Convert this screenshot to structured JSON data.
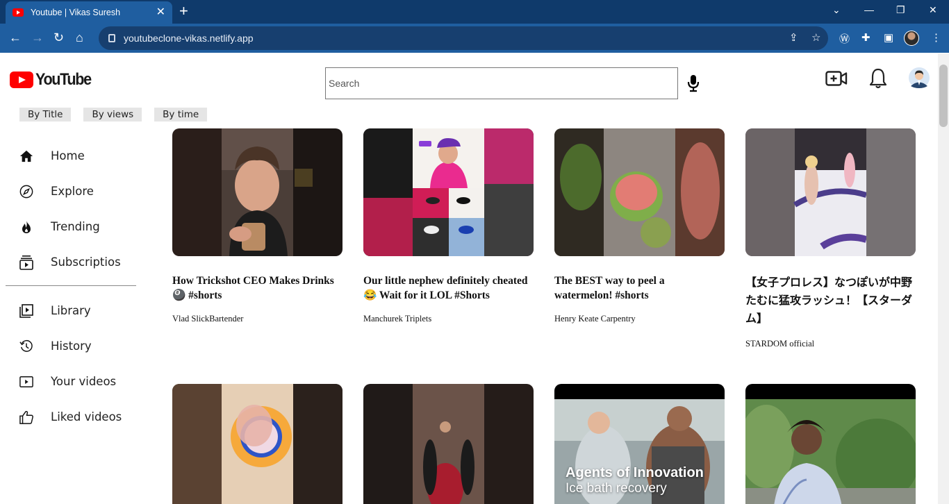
{
  "browser": {
    "tab_title": "Youtube | Vikas Suresh",
    "url": "youtubeclone-vikas.netlify.app"
  },
  "header": {
    "logo_text": "YouTube",
    "search_placeholder": "Search"
  },
  "filters": [
    "By Title",
    "By views",
    "By time"
  ],
  "sidebar": {
    "primary": [
      {
        "label": "Home",
        "icon": "home-icon"
      },
      {
        "label": "Explore",
        "icon": "compass-icon"
      },
      {
        "label": "Trending",
        "icon": "fire-icon"
      },
      {
        "label": "Subscriptios",
        "icon": "subscriptions-icon"
      }
    ],
    "secondary": [
      {
        "label": "Library",
        "icon": "library-icon"
      },
      {
        "label": "History",
        "icon": "history-icon"
      },
      {
        "label": "Your videos",
        "icon": "your-videos-icon"
      },
      {
        "label": "Liked videos",
        "icon": "thumbs-up-icon"
      }
    ]
  },
  "videos": [
    {
      "title": "How Trickshot CEO Makes Drinks 🎱 #shorts",
      "channel": "Vlad SlickBartender"
    },
    {
      "title": "Our little nephew definitely cheated 😂 Wait for it LOL #Shorts",
      "channel": "Manchurek Triplets"
    },
    {
      "title": "The BEST way to peel a watermelon! #shorts",
      "channel": "Henry Keate Carpentry"
    },
    {
      "title": "【女子プロレス】なつぽいが中野たむに猛攻ラッシュ！【スターダム】",
      "channel": "STARDOM official"
    },
    {
      "title": "",
      "channel": ""
    },
    {
      "title": "",
      "channel": ""
    },
    {
      "title": "",
      "channel": "",
      "overlay_line1": "Agents of Innovation",
      "overlay_line2": "Ice bath recovery"
    },
    {
      "title": "",
      "channel": ""
    }
  ]
}
